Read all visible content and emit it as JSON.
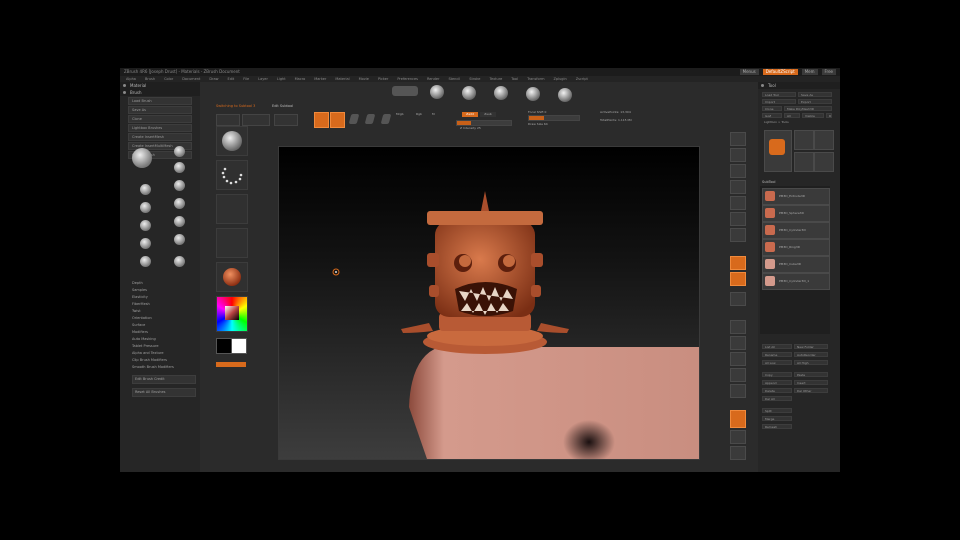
{
  "window": {
    "title": "ZBrush 4R6 [Joseph Drust] - Materials - ZBrush Document",
    "right_chips": [
      "Menus",
      "DefaultZScript",
      "Mem",
      "Free"
    ]
  },
  "menubar": [
    "Alpha",
    "Brush",
    "Color",
    "Document",
    "Draw",
    "Edit",
    "File",
    "Layer",
    "Light",
    "Macro",
    "Marker",
    "Material",
    "Movie",
    "Picker",
    "Preferences",
    "Render",
    "Stencil",
    "Stroke",
    "Texture",
    "Tool",
    "Transform",
    "Zplugin",
    "Zscript"
  ],
  "left_panel": {
    "title": "Material",
    "subtitle": "Brush",
    "buttons": [
      "Load Brush",
      "Save As",
      "Clone",
      "Lightbox Brushes",
      "Create InsertMesh",
      "Create InsertMultiMesh",
      "Create Brush"
    ],
    "menu": [
      "Depth",
      "Samples",
      "Elasticity",
      "FiberMesh",
      "Twist",
      "Orientation",
      "Surface",
      "Modifiers",
      "Auto Masking",
      "Tablet Pressure",
      "Alpha and Texture",
      "Clip Brush Modifiers",
      "Smooth Brush Modifiers"
    ],
    "footer": [
      "Edit Brush Credit",
      "Reset All Brushes"
    ]
  },
  "top_bar": {
    "heading": "Switching to Subtool 3",
    "subheading": "Edit Subtool",
    "tools": [
      "Projection Master",
      "LightBox",
      "Quick Sketch",
      "Edit",
      "Draw",
      "Move",
      "Scale",
      "Rotate"
    ],
    "modes": [
      "Mrgb",
      "Rgb",
      "M"
    ],
    "zadd_label": "Zadd",
    "zsub_label": "Zsub",
    "focal_label": "Focal Shift 0",
    "draw_size_label": "Draw Size 64",
    "z_intensity_label": "Z Intensity 25",
    "rgb_intensity_label": "Rgb Intensity 100",
    "active_points": "ActivePoints: 13,304",
    "total_points": "TotalPoints: 1.115 Mil"
  },
  "right_panel": {
    "title": "Tool",
    "buttons": [
      "Load Tool",
      "Save As",
      "Import",
      "Export",
      "Clone",
      "Make PolyMesh3D",
      "GoZ",
      "All",
      "Visible",
      "R",
      "Lightbox > Tools"
    ],
    "subtool_header": "SubTool",
    "subtools": [
      "PM3D_Extrude3D",
      "PM3D_Sphere3D",
      "PM3D_Cylinder3D",
      "PM3D_Ring3D",
      "PM3D_Cube3D",
      "PM3D_Cylinder3D_1"
    ],
    "lower": [
      "List All",
      "New Folder",
      "Rename",
      "AutoReorder",
      "All Low",
      "All High",
      "Copy",
      "Paste",
      "Append",
      "Insert",
      "Delete",
      "Del Other",
      "Del All",
      "Split",
      "Merge",
      "Remesh"
    ]
  },
  "colors": {
    "accent": "#d86a1c",
    "clay": "#b85a35",
    "skin": "#d49a8c",
    "panel": "#2b2b2b"
  }
}
